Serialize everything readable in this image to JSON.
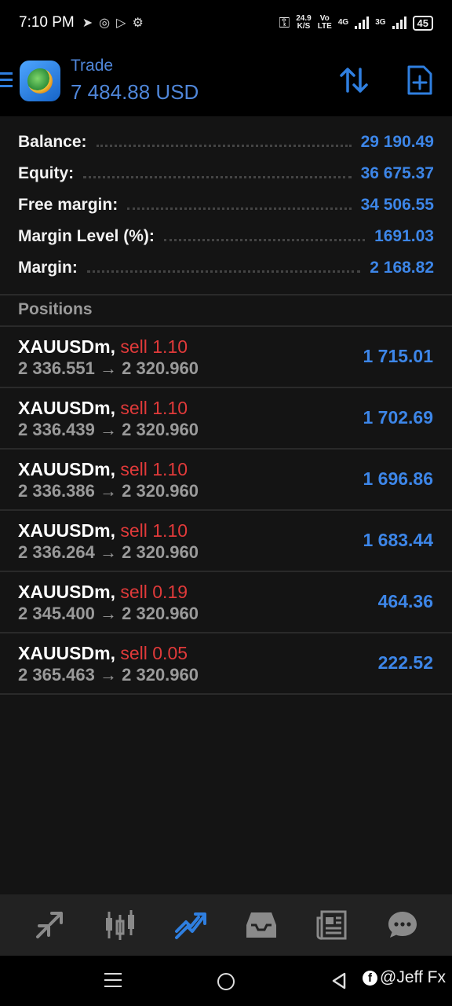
{
  "status_bar": {
    "time": "7:10 PM",
    "speed_value": "24.9",
    "speed_unit": "K/S",
    "vo_top": "Vo",
    "vo_bottom": "LTE",
    "net_4g": "4G",
    "net_3g": "3G",
    "battery": "45",
    "icons": [
      "telegram-icon",
      "chrome-icon",
      "play-icon",
      "settings-gear-icon",
      "key-icon"
    ]
  },
  "header": {
    "title": "Trade",
    "balance_display": "7 484.88 USD",
    "accent_color": "#3d86e8"
  },
  "summary": [
    {
      "label": "Balance:",
      "value": "29 190.49"
    },
    {
      "label": "Equity:",
      "value": "36 675.37"
    },
    {
      "label": "Free margin:",
      "value": "34 506.55"
    },
    {
      "label": "Margin Level (%):",
      "value": "1691.03"
    },
    {
      "label": "Margin:",
      "value": "2 168.82"
    }
  ],
  "positions_header": "Positions",
  "positions": [
    {
      "symbol": "XAUUSDm,",
      "side": "sell",
      "lots": "1.10",
      "open_price": "2 336.551",
      "arrow": "→",
      "current_price": "2 320.960",
      "profit": "1 715.01"
    },
    {
      "symbol": "XAUUSDm,",
      "side": "sell",
      "lots": "1.10",
      "open_price": "2 336.439",
      "arrow": "→",
      "current_price": "2 320.960",
      "profit": "1 702.69"
    },
    {
      "symbol": "XAUUSDm,",
      "side": "sell",
      "lots": "1.10",
      "open_price": "2 336.386",
      "arrow": "→",
      "current_price": "2 320.960",
      "profit": "1 696.86"
    },
    {
      "symbol": "XAUUSDm,",
      "side": "sell",
      "lots": "1.10",
      "open_price": "2 336.264",
      "arrow": "→",
      "current_price": "2 320.960",
      "profit": "1 683.44"
    },
    {
      "symbol": "XAUUSDm,",
      "side": "sell",
      "lots": "0.19",
      "open_price": "2 345.400",
      "arrow": "→",
      "current_price": "2 320.960",
      "profit": "464.36"
    },
    {
      "symbol": "XAUUSDm,",
      "side": "sell",
      "lots": "0.05",
      "open_price": "2 365.463",
      "arrow": "→",
      "current_price": "2 320.960",
      "profit": "222.52"
    }
  ],
  "bottom_nav": {
    "items": [
      "quotes-icon",
      "chart-icon",
      "trade-icon",
      "history-icon",
      "news-icon",
      "messages-icon"
    ],
    "active": "trade-icon"
  },
  "watermark": "@Jeff Fx"
}
